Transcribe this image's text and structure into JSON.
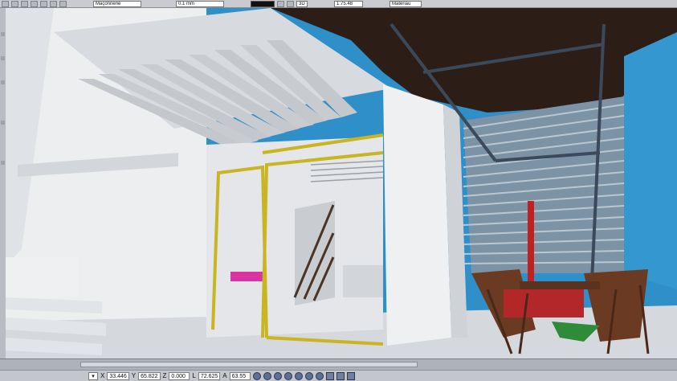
{
  "toolbar": {
    "layer_value": "Maçonnerie",
    "line_width_value": "0.1 mm",
    "scale_value": "1:75.48",
    "mode_label": "Matériau",
    "view_label": "3D"
  },
  "status": {
    "x_label": "X",
    "x_value": "33.446",
    "y_label": "Y",
    "y_value": "65.822",
    "z_label": "Z",
    "z_value": "0.000",
    "l_label": "L",
    "l_value": "72.625",
    "a_label": "A",
    "a_value": "63.55"
  },
  "colors": {
    "beam_yellow": "#c8b521",
    "wall": "#eceef0",
    "sky": "#2f8fc8",
    "ceiling": "#2c1d16",
    "railing_red": "#c02020",
    "chair_wood": "#6a3a22"
  },
  "icons": {
    "status_nav": [
      "zoom-icon",
      "zoom-window-icon",
      "zoom-prev-icon",
      "pan-icon",
      "orbit-icon",
      "back-icon",
      "forward-icon",
      "view-3d-icon"
    ]
  }
}
